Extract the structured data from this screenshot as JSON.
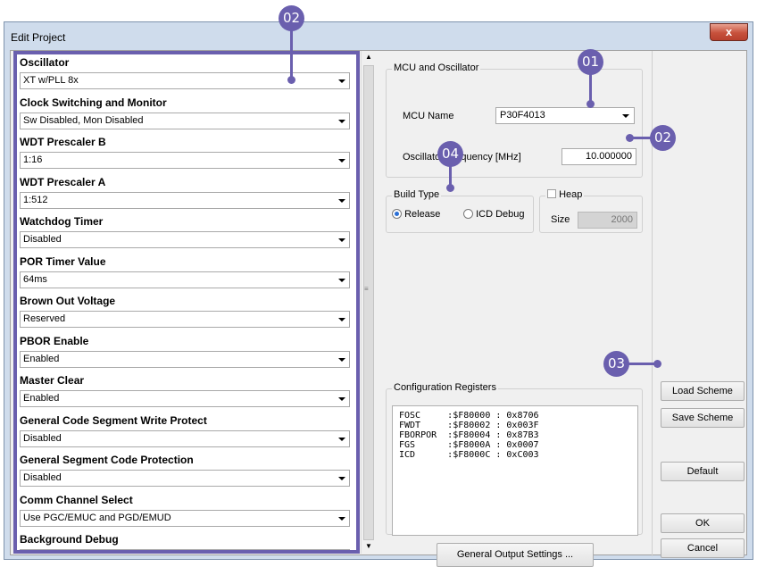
{
  "window": {
    "title": "Edit Project",
    "close_label": "x"
  },
  "config_fields": [
    {
      "label": "Oscillator",
      "value": "XT w/PLL 8x"
    },
    {
      "label": "Clock Switching and Monitor",
      "value": "Sw Disabled, Mon Disabled"
    },
    {
      "label": "WDT Prescaler B",
      "value": "1:16"
    },
    {
      "label": "WDT Prescaler A",
      "value": "1:512"
    },
    {
      "label": "Watchdog Timer",
      "value": "Disabled"
    },
    {
      "label": "POR Timer Value",
      "value": "64ms"
    },
    {
      "label": "Brown Out Voltage",
      "value": "Reserved"
    },
    {
      "label": "PBOR Enable",
      "value": "Enabled"
    },
    {
      "label": "Master Clear",
      "value": "Enabled"
    },
    {
      "label": "General Code Segment Write Protect",
      "value": "Disabled"
    },
    {
      "label": "General Segment Code Protection",
      "value": "Disabled"
    },
    {
      "label": "Comm Channel Select",
      "value": "Use PGC/EMUC and PGD/EMUD"
    },
    {
      "label": "Background Debug",
      "value": ""
    }
  ],
  "mcu": {
    "group_title": "MCU and Oscillator",
    "name_label": "MCU Name",
    "name_value": "P30F4013",
    "freq_label": "Oscillator Frequency [MHz]",
    "freq_value": "10.000000"
  },
  "build_type": {
    "group_title": "Build Type",
    "release_label": "Release",
    "icd_label": "ICD Debug",
    "selected": "Release"
  },
  "heap": {
    "group_title": "Heap",
    "size_label": "Size",
    "size_value": "2000",
    "checked": false
  },
  "registers": {
    "group_title": "Configuration Registers",
    "rows": [
      "FOSC     :$F80000 : 0x8706",
      "FWDT     :$F80002 : 0x003F",
      "FBORPOR  :$F80004 : 0x87B3",
      "FGS      :$F8000A : 0x0007",
      "ICD      :$F8000C : 0xC003"
    ]
  },
  "buttons": {
    "general_output": "General Output Settings ...",
    "load_scheme": "Load Scheme",
    "save_scheme": "Save Scheme",
    "default": "Default",
    "ok": "OK",
    "cancel": "Cancel"
  },
  "callouts": {
    "c01": "01",
    "c02_left": "02",
    "c02_right": "02",
    "c03": "03",
    "c04": "04"
  },
  "colors": {
    "accent": "#6a5fae",
    "window_frame": "#cfdcec"
  }
}
